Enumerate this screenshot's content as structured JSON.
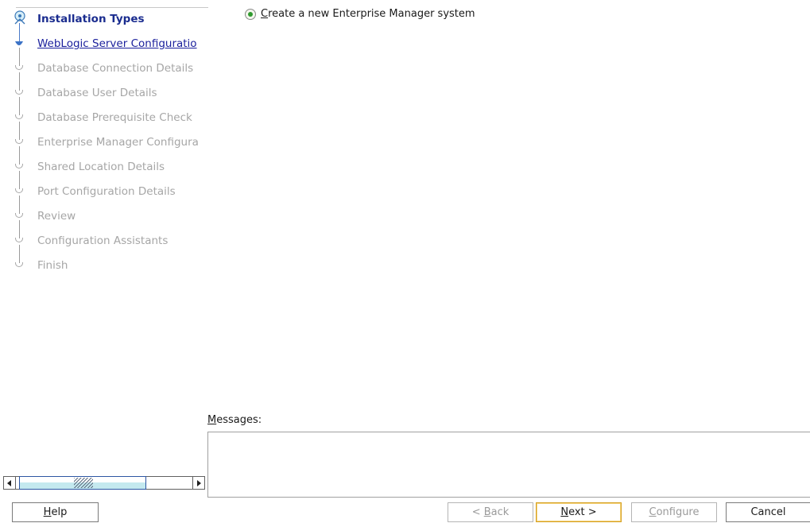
{
  "nav": {
    "steps": [
      {
        "label": "Installation Types",
        "state": "done"
      },
      {
        "label": "WebLogic Server Configuratio",
        "state": "current"
      },
      {
        "label": "Database Connection Details",
        "state": "pending"
      },
      {
        "label": "Database User Details",
        "state": "pending"
      },
      {
        "label": "Database Prerequisite Check",
        "state": "pending"
      },
      {
        "label": "Enterprise Manager Configura",
        "state": "pending"
      },
      {
        "label": "Shared Location Details",
        "state": "pending"
      },
      {
        "label": "Port Configuration Details",
        "state": "pending"
      },
      {
        "label": "Review",
        "state": "pending"
      },
      {
        "label": "Configuration Assistants",
        "state": "pending"
      },
      {
        "label": "Finish",
        "state": "pending"
      }
    ]
  },
  "main": {
    "option": {
      "mnemonic": "C",
      "rest": "reate a new Enterprise Manager system",
      "selected": true
    }
  },
  "messages": {
    "mnemonic": "M",
    "rest": "essages:",
    "content": ""
  },
  "buttons": {
    "help": {
      "mnemonic": "H",
      "rest": "elp"
    },
    "back": {
      "prefix": "< ",
      "mnemonic": "B",
      "rest": "ack",
      "enabled": false
    },
    "next": {
      "mnemonic": "N",
      "rest": "ext >",
      "enabled": true
    },
    "configure": {
      "mnemonic": "C",
      "rest": "onfigure",
      "enabled": false
    },
    "cancel": {
      "label": "Cancel"
    }
  },
  "colors": {
    "done_step": "#1a2c8f",
    "current_step": "#1a1f9c",
    "pending_step": "#a6a6a6",
    "radio_selected": "#2f9a2f",
    "default_button_border": "#d6a020"
  },
  "icons": {
    "done_step": "globe-person-icon",
    "current_step": "active-step-icon",
    "pending_step": "pending-step-icon"
  }
}
